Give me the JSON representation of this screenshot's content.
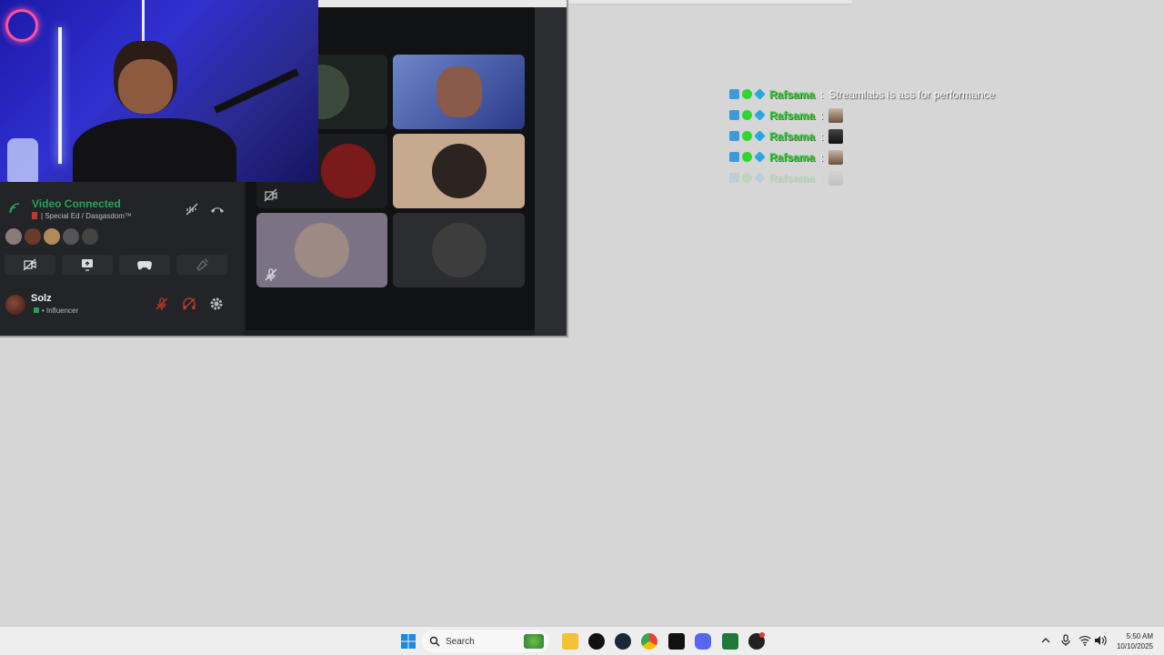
{
  "voice": {
    "status": "Video Connected",
    "channel": "Special Ed / Dasgasdom™"
  },
  "user": {
    "name": "Solz",
    "status": "• Influencer"
  },
  "chat": {
    "lines": [
      {
        "user": "Rafsama",
        "sep": ":",
        "message": "Streamlabs is ass for performance"
      },
      {
        "user": "Rafsama",
        "sep": ":",
        "message": ""
      },
      {
        "user": "Rafsama",
        "sep": ":",
        "message": ""
      },
      {
        "user": "Rafsama",
        "sep": ":",
        "message": ""
      },
      {
        "user": "Rafsama",
        "sep": ":",
        "message": ""
      }
    ]
  },
  "taskbar": {
    "search_label": "Search",
    "time": "5:50 AM",
    "date": "10/10/2025"
  },
  "colors": {
    "voice_green": "#23a559",
    "chat_user": "#2fd62f",
    "webcam_blue": "#2a2ad0"
  }
}
